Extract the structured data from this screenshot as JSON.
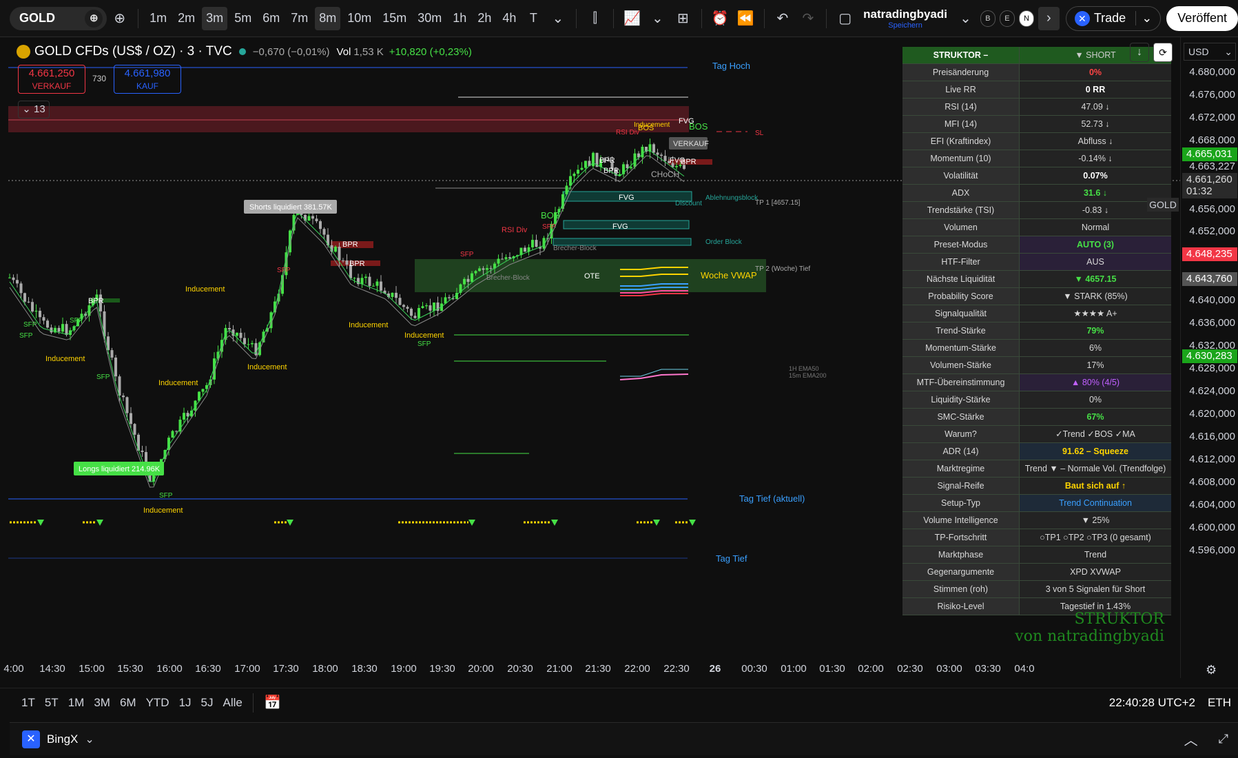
{
  "toolbar": {
    "symbol": "GOLD",
    "timeframes": [
      "1m",
      "2m",
      "3m",
      "5m",
      "6m",
      "7m",
      "8m",
      "10m",
      "15m",
      "30m",
      "1h",
      "2h",
      "4h",
      "T"
    ],
    "active_timeframes": [
      "3m",
      "8m"
    ],
    "layout_name": "natradingbyadi",
    "layout_sub": "Speichern",
    "badges": [
      "B",
      "E",
      "N"
    ],
    "trade_label": "Trade",
    "publish_label": "Veröffent"
  },
  "legend": {
    "title": "GOLD CFDs (US$ / OZ) · 3 · TVC",
    "change": "−0,670 (−0,01%)",
    "vol_label": "Vol",
    "vol_value": "1,53 K",
    "ind_change": "+10,820 (+0,23%)",
    "sell_price": "4.661,250",
    "sell_label": "VERKAUF",
    "spread": "730",
    "buy_price": "4.661,980",
    "buy_label": "KAUF",
    "collapse_count": "13"
  },
  "price_axis": {
    "currency": "USD",
    "ticks": [
      "4.680,000",
      "4.676,000",
      "4.672,000",
      "4.668,000",
      "4.663,227",
      "4.656,000",
      "4.652,000",
      "4.640,000",
      "4.636,000",
      "4.632,000",
      "4.628,000",
      "4.624,000",
      "4.620,000",
      "4.616,000",
      "4.612,000",
      "4.608,000",
      "4.604,000",
      "4.600,000",
      "4.596,000"
    ],
    "tag_green": "4.665,031",
    "tag_current": "4.661,260",
    "tag_timer": "01:32",
    "tag_red": "4.648,235",
    "tag_gray": "4.643,760",
    "tag_green2": "4.630,283",
    "symbol_tag": "GOLD"
  },
  "time_axis": [
    "4:00",
    "14:30",
    "15:00",
    "15:30",
    "16:00",
    "16:30",
    "17:00",
    "17:30",
    "18:00",
    "18:30",
    "19:00",
    "19:30",
    "20:00",
    "20:30",
    "21:00",
    "21:30",
    "22:00",
    "22:30",
    "26",
    "00:30",
    "01:00",
    "01:30",
    "02:00",
    "02:30",
    "03:00",
    "03:30",
    "04:0"
  ],
  "range_bar": {
    "ranges": [
      "1T",
      "5T",
      "1M",
      "3M",
      "6M",
      "YTD",
      "1J",
      "5J",
      "Alle"
    ],
    "clock": "22:40:28 UTC+2",
    "session": "ETH"
  },
  "broker": {
    "name": "BingX"
  },
  "table": {
    "header_left": "STRUKTOR – natradingbyadi",
    "header_right": "▼ SHORT",
    "rows": [
      {
        "k": "Preisänderung",
        "v": "0%",
        "color": "#ff4444",
        "bg": "#232323"
      },
      {
        "k": "Live RR",
        "v": "0 RR",
        "color": "#ffffff",
        "bg": "#232323"
      },
      {
        "k": "RSI (14)",
        "v": "47.09 ↓",
        "color": "#d8d8d8",
        "bg": "#232323"
      },
      {
        "k": "MFI (14)",
        "v": "52.73 ↓",
        "color": "#d8d8d8",
        "bg": "#232323"
      },
      {
        "k": "EFI (Kraftindex)",
        "v": "Abfluss ↓",
        "color": "#d8d8d8",
        "bg": "#232323"
      },
      {
        "k": "Momentum (10)",
        "v": "-0.14% ↓",
        "color": "#d8d8d8",
        "bg": "#232323"
      },
      {
        "k": "Volatilität",
        "v": "0.07%",
        "color": "#ffffff",
        "bg": "#232323"
      },
      {
        "k": "ADX",
        "v": "31.6 ↓",
        "color": "#46e046",
        "bg": "#232323"
      },
      {
        "k": "Trendstärke (TSI)",
        "v": "-0.83 ↓",
        "color": "#d8d8d8",
        "bg": "#232323"
      },
      {
        "k": "Volumen",
        "v": "Normal",
        "color": "#d8d8d8",
        "bg": "#232323"
      },
      {
        "k": "Preset-Modus",
        "v": "AUTO (3)",
        "color": "#46e046",
        "bg": "#2a2038"
      },
      {
        "k": "HTF-Filter",
        "v": "AUS",
        "color": "#d8d8d8",
        "bg": "#2a2038"
      },
      {
        "k": "Nächste Liquidität",
        "v": "▼ 4657.15",
        "color": "#46e046",
        "bg": "#232323"
      },
      {
        "k": "Probability Score",
        "v": "▼ STARK (85%)",
        "color": "#d8d8d8",
        "bg": "#232323"
      },
      {
        "k": "Signalqualität",
        "v": "★★★★ A+",
        "color": "#d8d8d8",
        "bg": "#232323"
      },
      {
        "k": "Trend-Stärke",
        "v": "79%",
        "color": "#46e046",
        "bg": "#232323"
      },
      {
        "k": "Momentum-Stärke",
        "v": "6%",
        "color": "#d8d8d8",
        "bg": "#232323"
      },
      {
        "k": "Volumen-Stärke",
        "v": "17%",
        "color": "#d8d8d8",
        "bg": "#232323"
      },
      {
        "k": "MTF-Übereinstimmung",
        "v": "▲ 80% (4/5)",
        "color": "#c060ff",
        "bg": "#2a2038"
      },
      {
        "k": "Liquidity-Stärke",
        "v": "0%",
        "color": "#d8d8d8",
        "bg": "#232323"
      },
      {
        "k": "SMC-Stärke",
        "v": "67%",
        "color": "#46e046",
        "bg": "#232323"
      },
      {
        "k": "Warum?",
        "v": "✓Trend ✓BOS ✓MA",
        "color": "#d8d8d8",
        "bg": "#232323"
      },
      {
        "k": "ADR (14)",
        "v": "91.62 – Squeeze",
        "color": "#ffd400",
        "bg": "#1e2a38"
      },
      {
        "k": "Marktregime",
        "v": "Trend ▼ – Normale Vol. (Trendfolge)",
        "color": "#d8d8d8",
        "bg": "#232323"
      },
      {
        "k": "Signal-Reife",
        "v": "Baut sich auf ↑",
        "color": "#ffd400",
        "bg": "#232323"
      },
      {
        "k": "Setup-Typ",
        "v": "Trend Continuation",
        "color": "#3aa0ff",
        "bg": "#1e2a38"
      },
      {
        "k": "Volume Intelligence",
        "v": "▼ 25%",
        "color": "#d8d8d8",
        "bg": "#232323"
      },
      {
        "k": "TP-Fortschritt",
        "v": "○TP1 ○TP2 ○TP3 (0 gesamt)",
        "color": "#d8d8d8",
        "bg": "#232323"
      },
      {
        "k": "Marktphase",
        "v": "Trend",
        "color": "#d8d8d8",
        "bg": "#232323"
      },
      {
        "k": "Gegenargumente",
        "v": "XPD XVWAP",
        "color": "#d8d8d8",
        "bg": "#232323"
      },
      {
        "k": "Stimmen (roh)",
        "v": "3 von 5 Signalen für Short",
        "color": "#d8d8d8",
        "bg": "#232323"
      },
      {
        "k": "Risiko-Level",
        "v": "Tagestief in 1.43%",
        "color": "#d8d8d8",
        "bg": "#232323"
      }
    ]
  },
  "watermark": {
    "line1": "STRUKTOR",
    "line2": "von natradingbyadi"
  },
  "chart_labels": {
    "tag_hoch": "Tag Hoch",
    "tag_tief_akt": "Tag Tief (aktuell)",
    "tag_tief": "Tag Tief",
    "woche_vwap": "Woche VWAP",
    "ablehnungsblock": "Ablehnungsblock",
    "order_block": "Order Block",
    "brecher_block": "Brecher-Block",
    "shorts_liq": "Shorts liquidiert 381.57K",
    "longs_liq": "Longs liquidiert 214.96K",
    "tp1": "TP 1 [4657.15]",
    "tp2": "TP 2 (Woche) Tief",
    "sl": "SL",
    "verkauf": "VERKAUF",
    "ote": "OTE",
    "discount": "Discount",
    "ema_1h": "1H EMA50",
    "ema_15m": "15m EMA200",
    "inducement": "Inducement",
    "bpr": "BPR",
    "sfp": "SFP",
    "fvg": "FVG",
    "bos": "BOS",
    "choch": "CHoCH",
    "rsi_div": "RSI Div"
  }
}
